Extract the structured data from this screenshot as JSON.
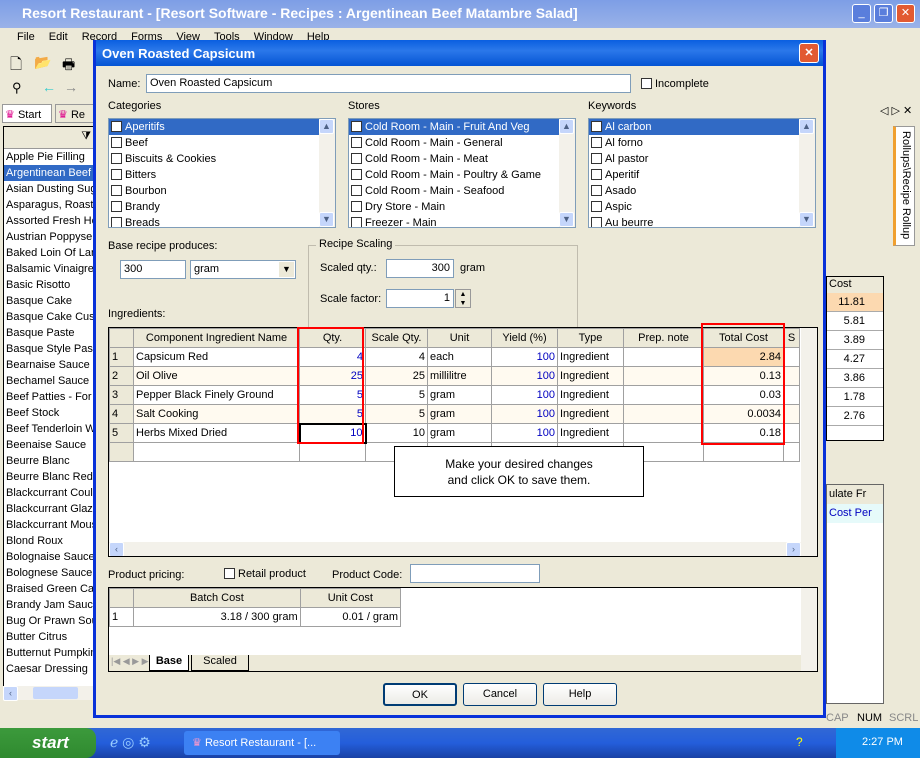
{
  "app": {
    "title": "Resort Restaurant - [Resort Software - Recipes : Argentinean Beef Matambre Salad]",
    "menu": [
      "File",
      "Edit",
      "Record",
      "Forms",
      "View",
      "Tools",
      "Window",
      "Help"
    ],
    "tabs": [
      "Start",
      "Re"
    ],
    "side_tab": "Rollups\\Recipe Rollup",
    "recipe_list": [
      "Apple Pie Filling",
      "Argentinean Beef",
      "Asian Dusting Sug",
      "Asparagus, Roast",
      "Assorted Fresh He",
      "Austrian Poppyse",
      "Baked Loin Of Lar",
      "Balsamic Vinaigret",
      "Basic Risotto",
      "Basque Cake",
      "Basque Cake Cus",
      "Basque Paste",
      "Basque Style Past",
      "Bearnaise Sauce",
      "Bechamel Sauce",
      "Beef Patties - For",
      "Beef Stock",
      "Beef Tenderloin W",
      "Beenaise Sauce",
      "Beurre Blanc",
      "Beurre Blanc Red",
      "Blackcurrant Couli",
      "Blackcurrant Glaz",
      "Blackcurrant Mous",
      "Blond Roux",
      "Bolognaise Sauce",
      "Bolognese Sauce",
      "Braised Green Cab",
      "Brandy Jam Sauce",
      "Bug Or Prawn Sou",
      "Butter Citrus",
      "Butternut Pumpkin",
      "Caesar Dressing"
    ],
    "rollup_header": "Cost",
    "rollup_values": [
      "11.81",
      "5.81",
      "3.89",
      "4.27",
      "3.86",
      "1.78",
      "2.76"
    ],
    "lower_header": "ulate Fr",
    "lower_cell": "Cost Per",
    "status": [
      "CAP",
      "NUM",
      "SCRL"
    ]
  },
  "dialog": {
    "title": "Oven Roasted Capsicum",
    "name_label": "Name:",
    "name_value": "Oven Roasted Capsicum",
    "incomplete_label": "Incomplete",
    "categories_label": "Categories",
    "categories": [
      "Aperitifs",
      "Beef",
      "Biscuits & Cookies",
      "Bitters",
      "Bourbon",
      "Brandy",
      "Breads"
    ],
    "stores_label": "Stores",
    "stores": [
      "Cold Room - Main - Fruit And Veg",
      "Cold Room - Main - General",
      "Cold Room - Main - Meat",
      "Cold Room - Main - Poultry & Game",
      "Cold Room - Main - Seafood",
      "Dry Store - Main",
      "Freezer - Main"
    ],
    "keywords_label": "Keywords",
    "keywords": [
      "Al carbon",
      "Al forno",
      "Al pastor",
      "Aperitif",
      "Asado",
      "Aspic",
      "Au beurre"
    ],
    "base_label": "Base recipe produces:",
    "base_qty": "300",
    "base_unit": "gram",
    "scaling_label": "Recipe Scaling",
    "scaled_qty_label": "Scaled qty.:",
    "scaled_qty": "300",
    "scaled_unit": "gram",
    "scale_factor_label": "Scale factor:",
    "scale_factor": "1",
    "ingredients_label": "Ingredients:",
    "columns": [
      "Component Ingredient Name",
      "Qty.",
      "Scale Qty.",
      "Unit",
      "Yield (%)",
      "Type",
      "Prep. note",
      "Total Cost",
      "S"
    ],
    "rows": [
      {
        "n": "1",
        "name": "Capsicum Red",
        "qty": "4",
        "sqty": "4",
        "unit": "each",
        "yield": "100",
        "type": "Ingredient",
        "note": "",
        "cost": "2.84"
      },
      {
        "n": "2",
        "name": "Oil Olive",
        "qty": "25",
        "sqty": "25",
        "unit": "millilitre",
        "yield": "100",
        "type": "Ingredient",
        "note": "",
        "cost": "0.13"
      },
      {
        "n": "3",
        "name": "Pepper Black Finely Ground",
        "qty": "5",
        "sqty": "5",
        "unit": "gram",
        "yield": "100",
        "type": "Ingredient",
        "note": "",
        "cost": "0.03"
      },
      {
        "n": "4",
        "name": "Salt Cooking",
        "qty": "5",
        "sqty": "5",
        "unit": "gram",
        "yield": "100",
        "type": "Ingredient",
        "note": "",
        "cost": "0.0034"
      },
      {
        "n": "5",
        "name": "Herbs Mixed Dried",
        "qty": "10",
        "sqty": "10",
        "unit": "gram",
        "yield": "100",
        "type": "Ingredient",
        "note": "",
        "cost": "0.18"
      }
    ],
    "tooltip_line1": "Make your desired changes",
    "tooltip_line2": "and click OK to save them.",
    "pricing_label": "Product pricing:",
    "retail_label": "Retail product",
    "code_label": "Product Code:",
    "code_value": "",
    "pricing_columns": [
      "Batch Cost",
      "Unit Cost"
    ],
    "pricing_row": {
      "n": "1",
      "batch": "3.18 / 300 gram",
      "unit": "0.01 / gram"
    },
    "bottom_tabs": [
      "Base",
      "Scaled"
    ],
    "ok": "OK",
    "cancel": "Cancel",
    "help": "Help"
  },
  "taskbar": {
    "start": "start",
    "task": "Resort Restaurant - [...",
    "clock": "2:27 PM"
  },
  "colors": {
    "highlight": "#fcd9b0",
    "selection": "#316ac5",
    "annotation": "#ff0000",
    "title_blue": "#0a5fe0"
  }
}
